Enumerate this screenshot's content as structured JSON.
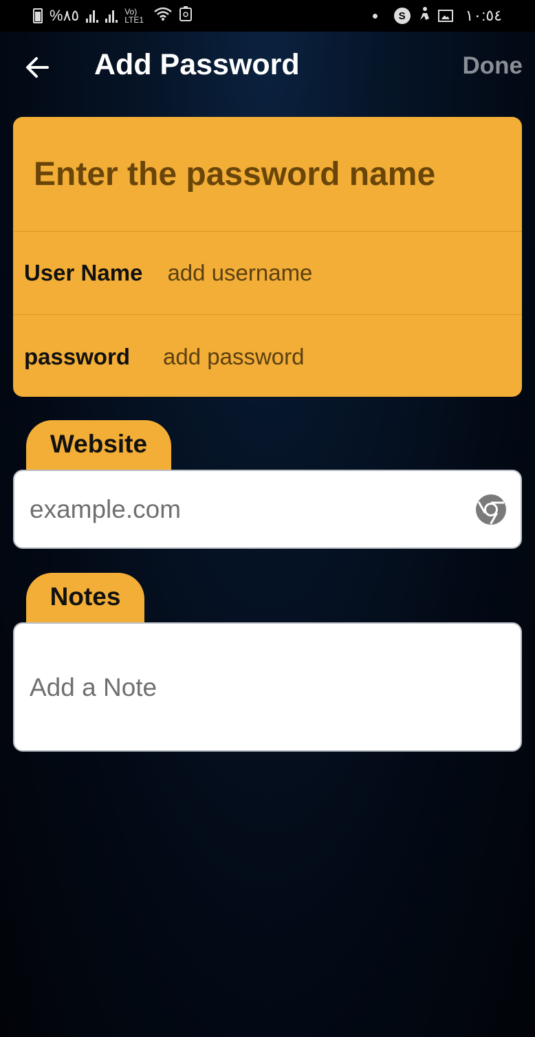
{
  "status_bar": {
    "battery_text": "%٨٥",
    "network_text": "Vo) LTE1",
    "time": "١٠:٥٤"
  },
  "header": {
    "back_icon": "arrow-left-icon",
    "title": "Add Password",
    "done_label": "Done"
  },
  "card": {
    "name_placeholder": "Enter the password name",
    "username_label": "User Name",
    "username_placeholder": "add username",
    "password_label": "password",
    "password_placeholder": "add password"
  },
  "website": {
    "tab_label": "Website",
    "placeholder": "example.com",
    "icon": "chrome-icon"
  },
  "notes": {
    "tab_label": "Notes",
    "placeholder": "Add a Note"
  },
  "colors": {
    "accent": "#f2ae36",
    "background": "#061529",
    "done_text": "#8a8f96"
  }
}
